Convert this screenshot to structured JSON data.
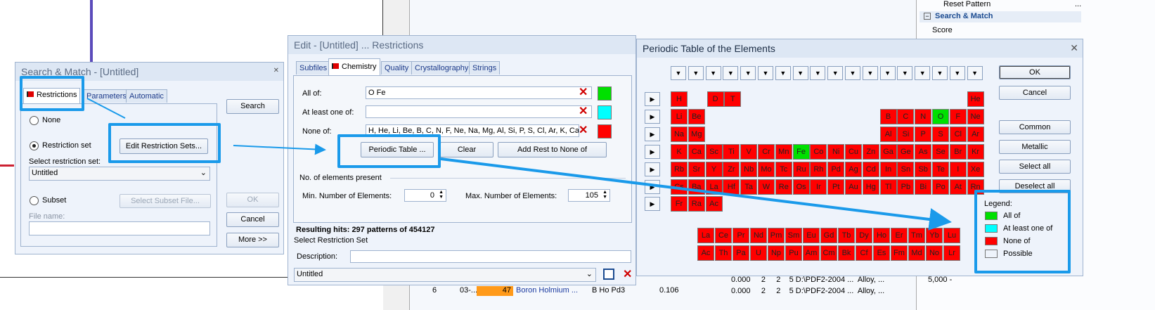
{
  "background": {
    "right_panel": {
      "reset_pattern": "Reset Pattern",
      "search_match": "Search & Match",
      "score": "Score",
      "more_dots": "..."
    },
    "list_rows": [
      {
        "a": "0.000",
        "b": "2",
        "c": "2",
        "d": "5 D:\\PDF2-2004 ...",
        "e": "Alloy, ..."
      },
      {
        "a": "0.000",
        "b": "2",
        "c": "2",
        "d": "5 D:\\PDF2-2004 ...",
        "e": "Alloy, ..."
      }
    ],
    "bottom_row": {
      "idx": "6",
      "ref": "03-...",
      "score": "47",
      "name": "Boron Holmium ...",
      "formula": "B Ho Pd3",
      "value": "0.106"
    },
    "axis_label": "5,000 -"
  },
  "search_match": {
    "title": "Search & Match - [Untitled]",
    "tabs": [
      "Restrictions",
      "Parameters",
      "Automatic"
    ],
    "radio_none": "None",
    "radio_restriction": "Restriction set",
    "edit_button": "Edit Restriction Sets...",
    "select_label": "Select restriction set:",
    "select_value": "Untitled",
    "radio_subset": "Subset",
    "select_subset_button": "Select Subset File...",
    "file_name_label": "File name:",
    "search_button": "Search",
    "ok_button": "OK",
    "cancel_button": "Cancel",
    "more_button": "More >>"
  },
  "edit": {
    "title": "Edit - [Untitled] ... Restrictions",
    "tabs": [
      "Subfiles",
      "Chemistry",
      "Quality",
      "Crystallography",
      "Strings"
    ],
    "all_of_label": "All of:",
    "all_of_value": "O Fe",
    "at_least_label": "At least one of:",
    "at_least_value": "",
    "none_of_label": "None of:",
    "none_of_value": "H, He, Li, Be, B, C, N, F, Ne, Na, Mg, Al, Si, P, S, Cl, Ar, K, Ca, Sc",
    "periodic_button": "Periodic Table ...",
    "clear_button": "Clear",
    "add_rest_button": "Add Rest to None of",
    "num_elements_label": "No. of elements present",
    "min_label": "Min. Number of Elements:",
    "min_value": "0",
    "max_label": "Max. Number of Elements:",
    "max_value": "105",
    "resulting_hits": "Resulting hits: 297 patterns of 454127",
    "select_set_label": "Select Restriction Set",
    "description_label": "Description:",
    "select_value": "Untitled",
    "colors": {
      "all_of": "#00e000",
      "at_least": "#00ffff",
      "none_of": "#ff0000"
    }
  },
  "periodic": {
    "title": "Periodic Table of the Elements",
    "ok_button": "OK",
    "cancel_button": "Cancel",
    "common_button": "Common",
    "metallic_button": "Metallic",
    "select_all_button": "Select all",
    "deselect_all_button": "Deselect all",
    "legend_title": "Legend:",
    "legend": [
      {
        "label": "All of",
        "color": "#00e000"
      },
      {
        "label": "At least one of",
        "color": "#00ffff"
      },
      {
        "label": "None of",
        "color": "#ff0000"
      },
      {
        "label": "Possible",
        "color": "#eef3fb"
      }
    ],
    "rows": [
      [
        "H",
        "",
        "",
        "",
        "",
        "",
        "",
        "",
        "",
        "",
        "",
        "",
        "",
        "",
        "",
        "",
        "",
        "He"
      ],
      [
        "Li",
        "Be",
        "",
        "",
        "",
        "",
        "",
        "",
        "",
        "",
        "",
        "",
        "B",
        "C",
        "N",
        "O",
        "F",
        "Ne"
      ],
      [
        "Na",
        "Mg",
        "",
        "",
        "",
        "",
        "",
        "",
        "",
        "",
        "",
        "",
        "Al",
        "Si",
        "P",
        "S",
        "Cl",
        "Ar"
      ],
      [
        "K",
        "Ca",
        "Sc",
        "Ti",
        "V",
        "Cr",
        "Mn",
        "Fe",
        "Co",
        "Ni",
        "Cu",
        "Zn",
        "Ga",
        "Ge",
        "As",
        "Se",
        "Br",
        "Kr"
      ],
      [
        "Rb",
        "Sr",
        "Y",
        "Zr",
        "Nb",
        "Mo",
        "Tc",
        "Ru",
        "Rh",
        "Pd",
        "Ag",
        "Cd",
        "In",
        "Sn",
        "Sb",
        "Te",
        "I",
        "Xe"
      ],
      [
        "Cs",
        "Ba",
        "La",
        "Hf",
        "Ta",
        "W",
        "Re",
        "Os",
        "Ir",
        "Pt",
        "Au",
        "Hg",
        "Tl",
        "Pb",
        "Bi",
        "Po",
        "At",
        "Rn"
      ],
      [
        "Fr",
        "Ra",
        "Ac",
        "",
        "",
        "",
        "",
        "",
        "",
        "",
        "",
        "",
        "",
        "",
        "",
        "",
        "",
        ""
      ]
    ],
    "row1_extra": [
      "D",
      "T"
    ],
    "lanthanides": [
      "La",
      "Ce",
      "Pr",
      "Nd",
      "Pm",
      "Sm",
      "Eu",
      "Gd",
      "Tb",
      "Dy",
      "Ho",
      "Er",
      "Tm",
      "Yb",
      "Lu"
    ],
    "actinides": [
      "Ac",
      "Th",
      "Pa",
      "U",
      "Np",
      "Pu",
      "Am",
      "Cm",
      "Bk",
      "Cf",
      "Es",
      "Fm",
      "Md",
      "No",
      "Lr"
    ],
    "green_elements": [
      "O",
      "Fe"
    ]
  }
}
